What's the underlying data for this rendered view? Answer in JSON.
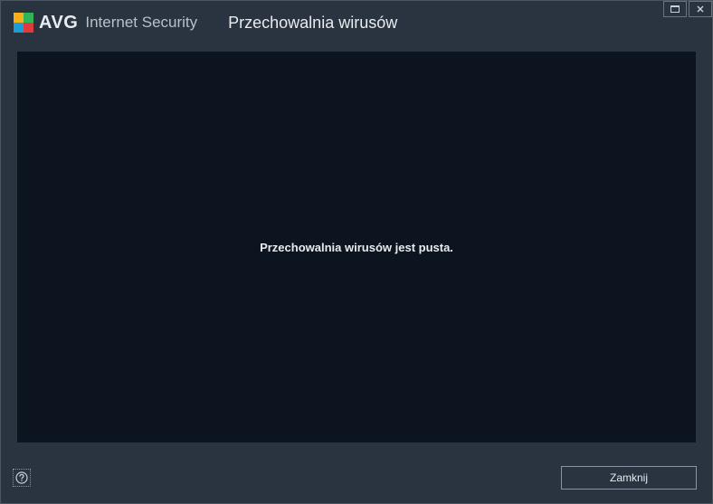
{
  "brand": {
    "name": "AVG",
    "suffix": "Internet Security"
  },
  "window": {
    "title": "Przechowalnia wirusów"
  },
  "content": {
    "empty_message": "Przechowalnia wirusów jest pusta."
  },
  "footer": {
    "close_label": "Zamknij"
  }
}
